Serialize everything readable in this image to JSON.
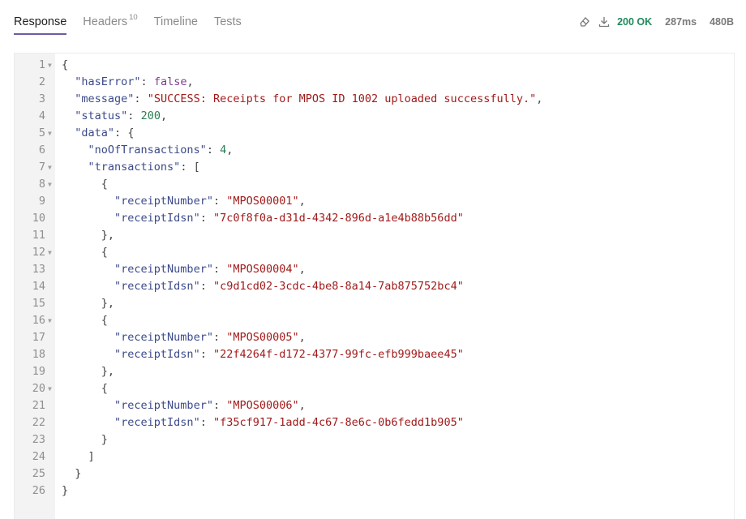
{
  "tabs": {
    "response": "Response",
    "headers": "Headers",
    "headers_count": "10",
    "timeline": "Timeline",
    "tests": "Tests"
  },
  "status": {
    "code": "200 OK",
    "time": "287ms",
    "size": "480B"
  },
  "editor": {
    "lines": [
      {
        "n": "1",
        "fold": true
      },
      {
        "n": "2",
        "key": "hasError",
        "value": "false",
        "vtype": "b",
        "indent": 1,
        "comma": true
      },
      {
        "n": "3",
        "key": "message",
        "value": "\"SUCCESS: Receipts for MPOS ID 1002 uploaded successfully.\"",
        "vtype": "s",
        "indent": 1,
        "comma": true
      },
      {
        "n": "4",
        "key": "status",
        "value": "200",
        "vtype": "n",
        "indent": 1,
        "comma": true
      },
      {
        "n": "5",
        "key": "data",
        "open": "{",
        "indent": 1,
        "fold": true
      },
      {
        "n": "6",
        "key": "noOfTransactions",
        "value": "4",
        "vtype": "n",
        "indent": 2,
        "comma": true
      },
      {
        "n": "7",
        "key": "transactions",
        "open": "[",
        "indent": 2,
        "fold": true
      },
      {
        "n": "8",
        "text": "{",
        "indent": 3,
        "fold": true
      },
      {
        "n": "9",
        "key": "receiptNumber",
        "value": "\"MPOS00001\"",
        "vtype": "s",
        "indent": 4,
        "comma": true
      },
      {
        "n": "10",
        "key": "receiptIdsn",
        "value": "\"7c0f8f0a-d31d-4342-896d-a1e4b88b56dd\"",
        "vtype": "s",
        "indent": 4
      },
      {
        "n": "11",
        "text": "},",
        "indent": 3
      },
      {
        "n": "12",
        "text": "{",
        "indent": 3,
        "fold": true
      },
      {
        "n": "13",
        "key": "receiptNumber",
        "value": "\"MPOS00004\"",
        "vtype": "s",
        "indent": 4,
        "comma": true
      },
      {
        "n": "14",
        "key": "receiptIdsn",
        "value": "\"c9d1cd02-3cdc-4be8-8a14-7ab875752bc4\"",
        "vtype": "s",
        "indent": 4
      },
      {
        "n": "15",
        "text": "},",
        "indent": 3
      },
      {
        "n": "16",
        "text": "{",
        "indent": 3,
        "fold": true
      },
      {
        "n": "17",
        "key": "receiptNumber",
        "value": "\"MPOS00005\"",
        "vtype": "s",
        "indent": 4,
        "comma": true
      },
      {
        "n": "18",
        "key": "receiptIdsn",
        "value": "\"22f4264f-d172-4377-99fc-efb999baee45\"",
        "vtype": "s",
        "indent": 4
      },
      {
        "n": "19",
        "text": "},",
        "indent": 3
      },
      {
        "n": "20",
        "text": "{",
        "indent": 3,
        "fold": true
      },
      {
        "n": "21",
        "key": "receiptNumber",
        "value": "\"MPOS00006\"",
        "vtype": "s",
        "indent": 4,
        "comma": true
      },
      {
        "n": "22",
        "key": "receiptIdsn",
        "value": "\"f35cf917-1add-4c67-8e6c-0b6fedd1b905\"",
        "vtype": "s",
        "indent": 4
      },
      {
        "n": "23",
        "text": "}",
        "indent": 3
      },
      {
        "n": "24",
        "text": "]",
        "indent": 2
      },
      {
        "n": "25",
        "text": "}",
        "indent": 1
      },
      {
        "n": "26",
        "text": "}",
        "indent": 0
      }
    ]
  },
  "icons": [
    "eraser-icon",
    "download-icon"
  ],
  "colors": {
    "accent": "#6b5ca5",
    "ok": "#1f8a5b",
    "string": "#a11a1a",
    "number": "#2b7b51",
    "boolean": "#7a3e8b",
    "key": "#3b4a8a"
  }
}
